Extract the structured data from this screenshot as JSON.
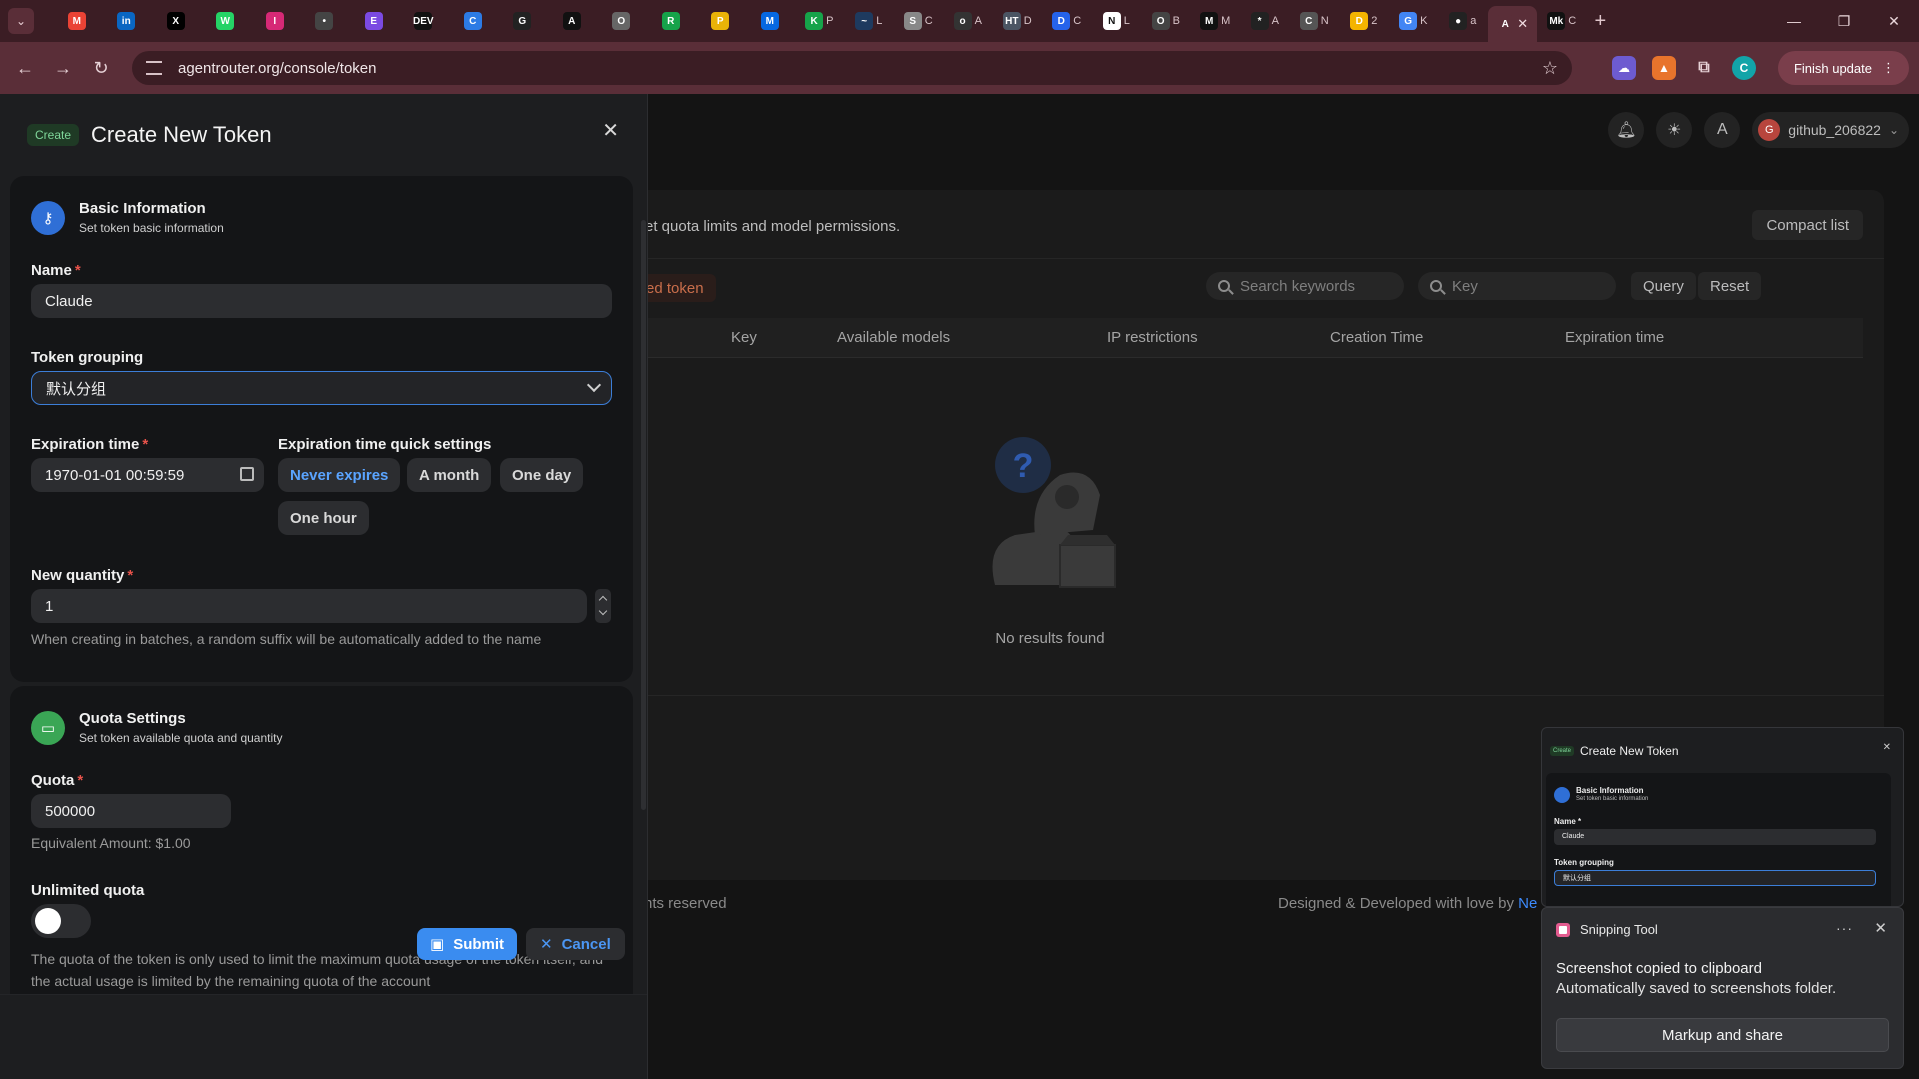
{
  "browser": {
    "tabs": [
      {
        "icon": "gmail-icon",
        "letter": "M",
        "color": "#ea4335",
        "title": ""
      },
      {
        "icon": "linkedin-icon",
        "letter": "in",
        "color": "#0a66c2",
        "title": ""
      },
      {
        "icon": "x-icon",
        "letter": "X",
        "color": "#000000",
        "title": ""
      },
      {
        "icon": "whatsapp-icon",
        "letter": "W",
        "color": "#25d366",
        "title": ""
      },
      {
        "icon": "instagram-icon",
        "letter": "I",
        "color": "#d62976",
        "title": ""
      },
      {
        "icon": "dots-icon",
        "letter": "•",
        "color": "#444444",
        "title": ""
      },
      {
        "icon": "app-icon",
        "letter": "E",
        "color": "#7b4ae2",
        "title": ""
      },
      {
        "icon": "dev-icon",
        "letter": "DEV",
        "color": "#111111",
        "title": ""
      },
      {
        "icon": "circle-app-icon",
        "letter": "C",
        "color": "#2c7be5",
        "title": ""
      },
      {
        "icon": "github-icon",
        "letter": "G",
        "color": "#222222",
        "title": ""
      },
      {
        "icon": "triangle-icon",
        "letter": "A",
        "color": "#111111",
        "title": ""
      },
      {
        "icon": "globe-icon",
        "letter": "O",
        "color": "#666666",
        "title": ""
      },
      {
        "icon": "square-app-icon",
        "letter": "R",
        "color": "#16a34a",
        "title": ""
      },
      {
        "icon": "pinwheel-icon",
        "letter": "P",
        "color": "#eab308",
        "title": ""
      },
      {
        "icon": "meta-icon",
        "letter": "M",
        "color": "#0668e1",
        "title": ""
      },
      {
        "icon": "k-icon",
        "letter": "K",
        "color": "#16a34a",
        "title": "P"
      },
      {
        "icon": "wave-icon",
        "letter": "~",
        "color": "#1e3a5f",
        "title": "L"
      },
      {
        "icon": "cam-icon",
        "letter": "S",
        "color": "#888888",
        "title": "C"
      },
      {
        "icon": "orb-icon",
        "letter": "o",
        "color": "#333333",
        "title": "A"
      },
      {
        "icon": "ht-icon",
        "letter": "HT",
        "color": "#4b5563",
        "title": "D"
      },
      {
        "icon": "doc-icon",
        "letter": "D",
        "color": "#2563eb",
        "title": "C"
      },
      {
        "icon": "notion-icon",
        "letter": "N",
        "color": "#ffffff",
        "title": "L"
      },
      {
        "icon": "openai-icon",
        "letter": "O",
        "color": "#444444",
        "title": "B"
      },
      {
        "icon": "medium-icon",
        "letter": "M",
        "color": "#111111",
        "title": "M"
      },
      {
        "icon": "sparkle-icon",
        "letter": "*",
        "color": "#222222",
        "title": "A"
      },
      {
        "icon": "chrome-icon",
        "letter": "C",
        "color": "#555555",
        "title": "N"
      },
      {
        "icon": "drive-icon",
        "letter": "D",
        "color": "#f4b400",
        "title": "2"
      },
      {
        "icon": "google-icon",
        "letter": "G",
        "color": "#4285f4",
        "title": "K"
      },
      {
        "icon": "dark-orb-icon",
        "letter": "●",
        "color": "#222222",
        "title": "a"
      },
      {
        "icon": "agent-icon",
        "letter": "A",
        "color": "#5a2e38",
        "title": ""
      },
      {
        "icon": "mk-icon",
        "letter": "Mk",
        "color": "#111111",
        "title": "C"
      }
    ],
    "url": "agentrouter.org/console/token",
    "finish_update": "Finish update"
  },
  "page": {
    "user": {
      "initial": "G",
      "name": "github_206822"
    },
    "description": "et quota limits and model permissions.",
    "compact_list": "Compact list",
    "disabled_token": "ed token",
    "search_keywords_placeholder": "Search keywords",
    "key_placeholder": "Key",
    "query": "Query",
    "reset": "Reset",
    "columns": [
      "Key",
      "Available models",
      "IP restrictions",
      "Creation Time",
      "Expiration time"
    ],
    "empty_message": "No results found",
    "footer_left": "hts reserved",
    "footer_right": "Designed & Developed with love by ",
    "footer_right_link": "Ne"
  },
  "sheet": {
    "badge": "Create",
    "title": "Create New Token",
    "basic": {
      "title": "Basic Information",
      "subtitle": "Set token basic information",
      "name_label": "Name",
      "name_value": "Claude",
      "grouping_label": "Token grouping",
      "grouping_value": "默认分组",
      "expiration_label": "Expiration time",
      "expiration_value": "1970-01-01 00:59:59",
      "quick_label": "Expiration time quick settings",
      "quick_options": [
        "Never expires",
        "A month",
        "One day",
        "One hour"
      ],
      "quantity_label": "New quantity",
      "quantity_value": "1",
      "quantity_help": "When creating in batches, a random suffix will be automatically added to the name"
    },
    "quota": {
      "title": "Quota Settings",
      "subtitle": "Set token available quota and quantity",
      "quota_label": "Quota",
      "quota_value": "500000",
      "equivalent": "Equivalent Amount: $1.00",
      "unlimited_label": "Unlimited quota",
      "unlimited_on": false,
      "help": "The quota of the token is only used to limit the maximum quota usage of the token itself, and the actual usage is limited by the remaining quota of the account"
    },
    "submit": "Submit",
    "cancel": "Cancel",
    "required_mark": "*"
  },
  "thumbnail": {
    "badge": "Create",
    "title": "Create New Token",
    "section_title": "Basic Information",
    "section_subtitle": "Set token basic information",
    "name_label": "Name *",
    "name_value": "Claude",
    "grouping_label": "Token grouping",
    "grouping_value": "默认分组"
  },
  "toast": {
    "app": "Snipping Tool",
    "line1": "Screenshot copied to clipboard",
    "line2": "Automatically saved to screenshots folder.",
    "action": "Markup and share"
  }
}
